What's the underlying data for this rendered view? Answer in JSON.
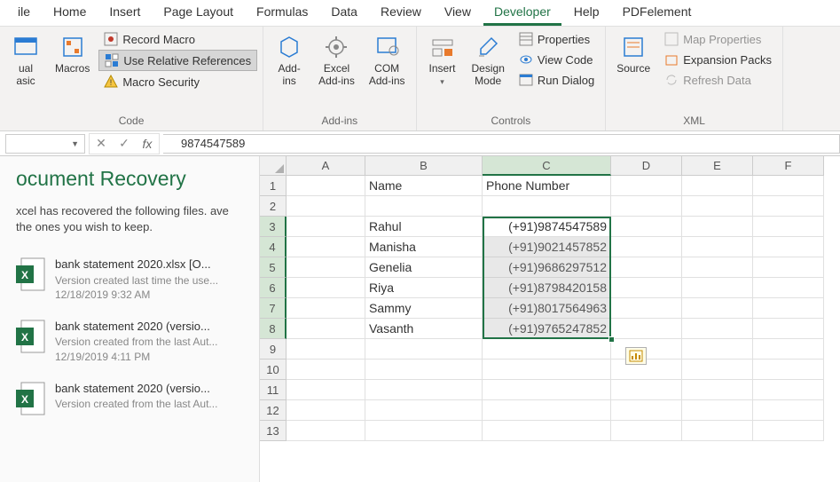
{
  "tabs": [
    "ile",
    "Home",
    "Insert",
    "Page Layout",
    "Formulas",
    "Data",
    "Review",
    "View",
    "Developer",
    "Help",
    "PDFelement"
  ],
  "active_tab": "Developer",
  "ribbon": {
    "group1_label": "Code",
    "visualbasic_l1": "ual",
    "visualbasic_l2": "asic",
    "macros": "Macros",
    "record_macro": "Record Macro",
    "use_relative": "Use Relative References",
    "macro_security": "Macro Security",
    "group2_label": "Add-ins",
    "addins_l1": "Add-",
    "addins_l2": "ins",
    "excel_l1": "Excel",
    "excel_l2": "Add-ins",
    "com_l1": "COM",
    "com_l2": "Add-ins",
    "group3_label": "Controls",
    "insert": "Insert",
    "design_l1": "Design",
    "design_l2": "Mode",
    "properties": "Properties",
    "view_code": "View Code",
    "run_dialog": "Run Dialog",
    "source": "Source",
    "group4_label": "XML",
    "map_properties": "Map Properties",
    "expansion_packs": "Expansion Packs",
    "refresh_data": "Refresh Data"
  },
  "formula_bar": {
    "name_box": "",
    "value": "9874547589"
  },
  "recovery": {
    "title": "ocument Recovery",
    "desc": "xcel has recovered the following files. ave the ones you wish to keep.",
    "items": [
      {
        "title": "bank statement 2020.xlsx  [O...",
        "sub": "Version created last time the use...",
        "date": "12/18/2019 9:32 AM"
      },
      {
        "title": "bank statement 2020 (versio...",
        "sub": "Version created from the last Aut...",
        "date": "12/19/2019 4:11 PM"
      },
      {
        "title": "bank statement 2020 (versio...",
        "sub": "Version created from the last Aut...",
        "date": ""
      }
    ]
  },
  "columns": [
    "A",
    "B",
    "C",
    "D",
    "E",
    "F"
  ],
  "rows": [
    {
      "n": "1",
      "b": "Name",
      "c": "Phone Number",
      "header": true
    },
    {
      "n": "2",
      "b": "",
      "c": ""
    },
    {
      "n": "3",
      "b": "Rahul",
      "c": "(+91)9874547589"
    },
    {
      "n": "4",
      "b": "Manisha",
      "c": "(+91)9021457852"
    },
    {
      "n": "5",
      "b": "Genelia",
      "c": "(+91)9686297512"
    },
    {
      "n": "6",
      "b": "Riya",
      "c": "(+91)8798420158"
    },
    {
      "n": "7",
      "b": "Sammy",
      "c": "(+91)8017564963"
    },
    {
      "n": "8",
      "b": "Vasanth",
      "c": "(+91)9765247852"
    },
    {
      "n": "9",
      "b": "",
      "c": ""
    },
    {
      "n": "10",
      "b": "",
      "c": ""
    },
    {
      "n": "11",
      "b": "",
      "c": ""
    },
    {
      "n": "12",
      "b": "",
      "c": ""
    },
    {
      "n": "13",
      "b": "",
      "c": ""
    }
  ],
  "chart_data": {
    "type": "table",
    "columns": [
      "Name",
      "Phone Number"
    ],
    "rows": [
      [
        "Rahul",
        "(+91)9874547589"
      ],
      [
        "Manisha",
        "(+91)9021457852"
      ],
      [
        "Genelia",
        "(+91)9686297512"
      ],
      [
        "Riya",
        "(+91)8798420158"
      ],
      [
        "Sammy",
        "(+91)8017564963"
      ],
      [
        "Vasanth",
        "(+91)9765247852"
      ]
    ],
    "selection": "C3:C8",
    "formula_bar_value": "9874547589"
  }
}
